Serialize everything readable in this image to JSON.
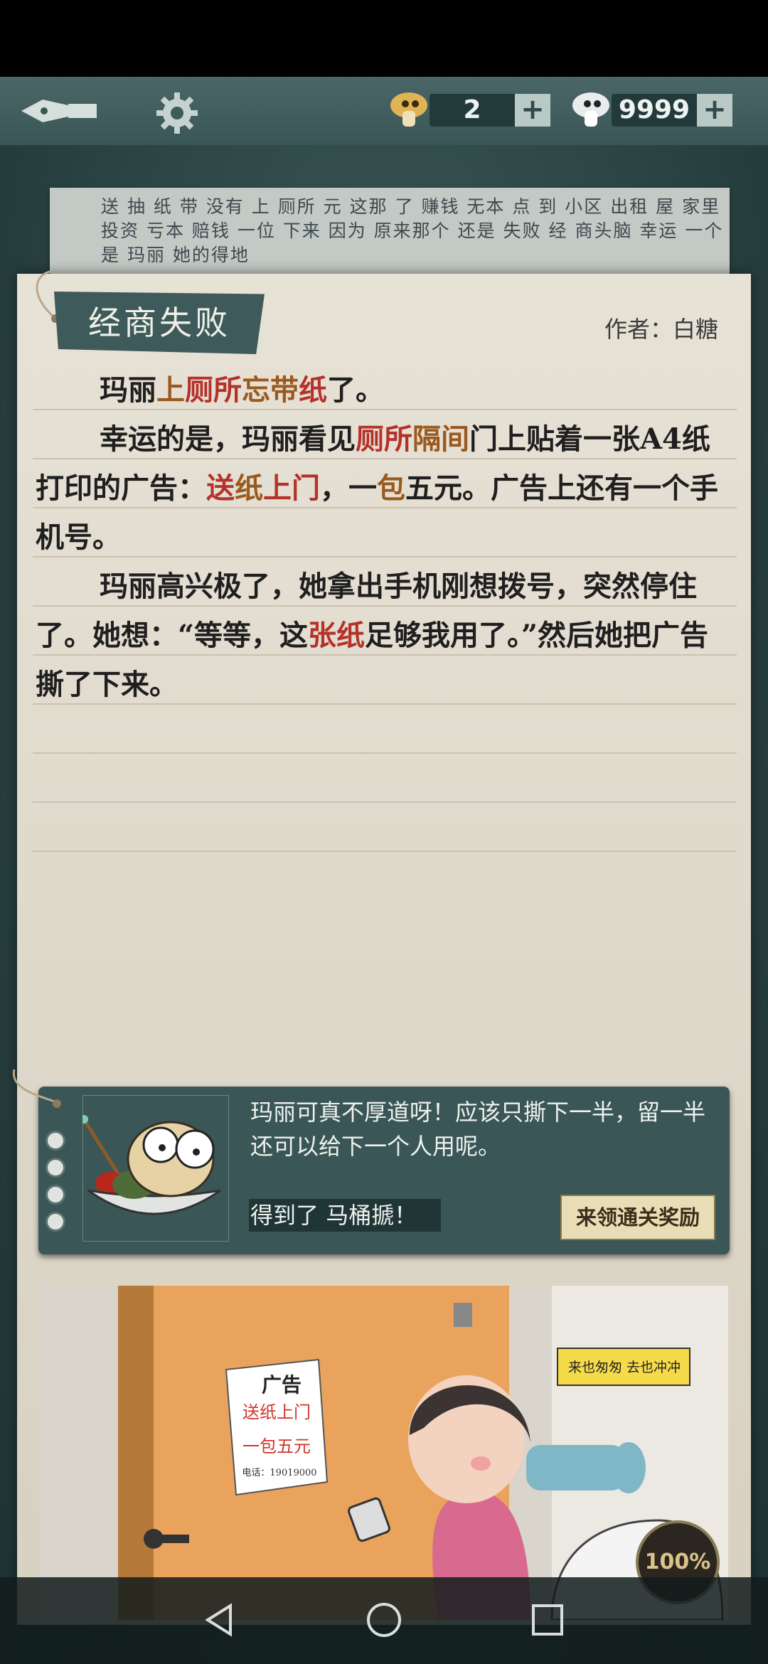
{
  "header": {
    "hint_count": "2",
    "coin_count": "9999",
    "plus": "+"
  },
  "hint_strip": {
    "text": "送 抽 纸 带 没有 上 厕所 元 这那 了 赚钱 无本 点 到 小区 出租 屋 家里 投资 亏本 赔钱 一位 下来 因为 原来那个 还是 失败 经 商头脑 幸运 一个 是 玛丽 她的得地"
  },
  "level": {
    "title": "经商失败",
    "author": "作者：白糖"
  },
  "story": {
    "p1": {
      "a": "玛丽",
      "b": "上",
      "c": "厕所",
      "d": "忘带",
      "e": "纸",
      "f": "了。"
    },
    "p2": {
      "a": "幸运的是，玛丽看见",
      "b": "厕所",
      "c": "隔间",
      "d": "门上贴着一张A4纸打印的广告：",
      "e": "送",
      "f": "纸",
      "g": "上门",
      "h": "，一",
      "i": "包",
      "j": "五元。广告上还有一个手机号。"
    },
    "p3": {
      "a": "玛丽高兴极了，她拿出手机刚想拨号，突然停住了。她想：“等等，这",
      "b": "张纸",
      "c": "足够我用了。”然后她把广告撕了下来。"
    }
  },
  "comment": {
    "text": "玛丽可真不厚道呀！应该只撕下一半，留一半还可以给下一个人用呢。",
    "gain_prefix": "得到了",
    "gain_item": "马桶搋！",
    "reward_button": "来领通关奖励"
  },
  "illustration": {
    "poster_title": "广告",
    "poster_line1": "送纸上门",
    "poster_line2": "一包五元",
    "poster_phone": "电话：19019000",
    "sign_text": "来也匆匆 去也冲冲",
    "progress": "100%"
  },
  "colors": {
    "highlight_red": "#b4322a",
    "highlight_brown": "#9a5a1e",
    "board": "#2a4242"
  }
}
